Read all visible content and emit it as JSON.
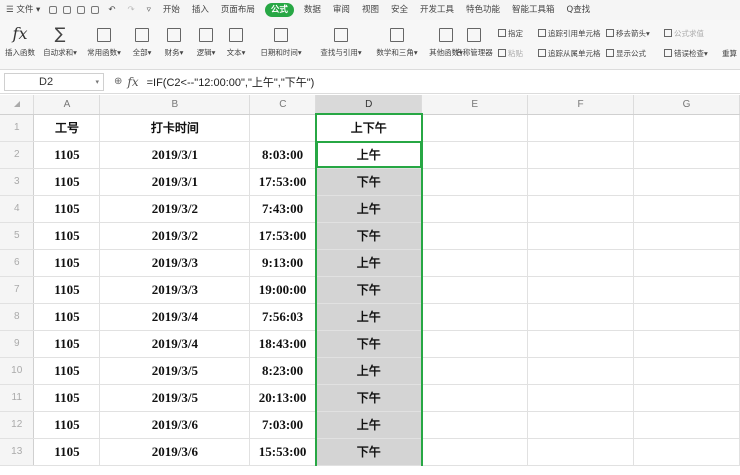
{
  "menu": {
    "file": "文件",
    "tabs": [
      "开始",
      "插入",
      "页面布局",
      "公式",
      "数据",
      "审阅",
      "视图",
      "安全",
      "开发工具",
      "特色功能",
      "智能工具箱"
    ],
    "active_tab": "公式",
    "search": "Q查找"
  },
  "ribbon": {
    "buttons": [
      "插入函数",
      "自动求和",
      "常用函数",
      "全部",
      "财务",
      "逻辑",
      "文本",
      "日期和时间",
      "查找与引用",
      "数学和三角",
      "其他函数",
      "名称管理器"
    ],
    "small": {
      "specify": "指定",
      "paste": "粘贴",
      "trace_precedents": "追踪引用单元格",
      "trace_dependents": "追踪从属单元格",
      "remove_arrows": "移去箭头",
      "show_formulas": "显示公式",
      "formula_audit": "公式求值",
      "error_check": "错误检查",
      "recalc": "重算"
    }
  },
  "formula_bar": {
    "cell_ref": "D2",
    "formula": "=IF(C2<--\"12:00:00\",\"上午\",\"下午\")"
  },
  "grid": {
    "columns": [
      "A",
      "B",
      "C",
      "D",
      "E",
      "F",
      "G"
    ],
    "selected_column": "D",
    "active_cell": "D2",
    "header_row": [
      "工号",
      "打卡时间",
      "",
      "上下午",
      "",
      "",
      ""
    ],
    "rows": [
      {
        "row": "2",
        "a": "1105",
        "b": "2019/3/1",
        "c": "8:03:00",
        "d": "上午"
      },
      {
        "row": "3",
        "a": "1105",
        "b": "2019/3/1",
        "c": "17:53:00",
        "d": "下午"
      },
      {
        "row": "4",
        "a": "1105",
        "b": "2019/3/2",
        "c": "7:43:00",
        "d": "上午"
      },
      {
        "row": "5",
        "a": "1105",
        "b": "2019/3/2",
        "c": "17:53:00",
        "d": "下午"
      },
      {
        "row": "6",
        "a": "1105",
        "b": "2019/3/3",
        "c": "9:13:00",
        "d": "上午"
      },
      {
        "row": "7",
        "a": "1105",
        "b": "2019/3/3",
        "c": "19:00:00",
        "d": "下午"
      },
      {
        "row": "8",
        "a": "1105",
        "b": "2019/3/4",
        "c": "7:56:03",
        "d": "上午"
      },
      {
        "row": "9",
        "a": "1105",
        "b": "2019/3/4",
        "c": "18:43:00",
        "d": "下午"
      },
      {
        "row": "10",
        "a": "1105",
        "b": "2019/3/5",
        "c": "8:23:00",
        "d": "上午"
      },
      {
        "row": "11",
        "a": "1105",
        "b": "2019/3/5",
        "c": "20:13:00",
        "d": "下午"
      },
      {
        "row": "12",
        "a": "1105",
        "b": "2019/3/6",
        "c": "7:03:00",
        "d": "上午"
      },
      {
        "row": "13",
        "a": "1105",
        "b": "2019/3/6",
        "c": "15:53:00",
        "d": "下午"
      }
    ]
  },
  "colors": {
    "accent": "#27a744",
    "selection": "#d4d4d4"
  }
}
